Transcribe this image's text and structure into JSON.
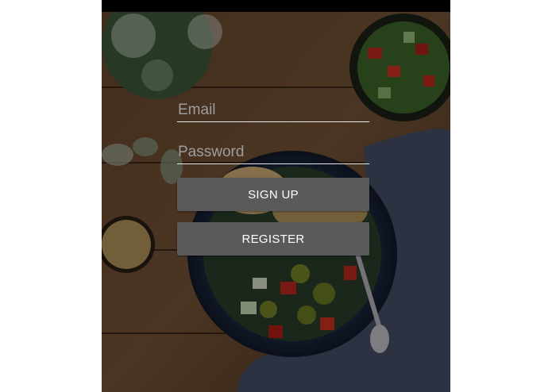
{
  "form": {
    "email_placeholder": "Email",
    "email_value": "",
    "password_placeholder": "Password",
    "password_value": "",
    "signup_label": "SIGN UP",
    "register_label": "REGISTER"
  },
  "colors": {
    "status_bar": "#000000",
    "button": "#5a5a5a",
    "button_text": "#ffffff",
    "underline": "#e6e6e6",
    "placeholder": "#9d9d9d"
  }
}
